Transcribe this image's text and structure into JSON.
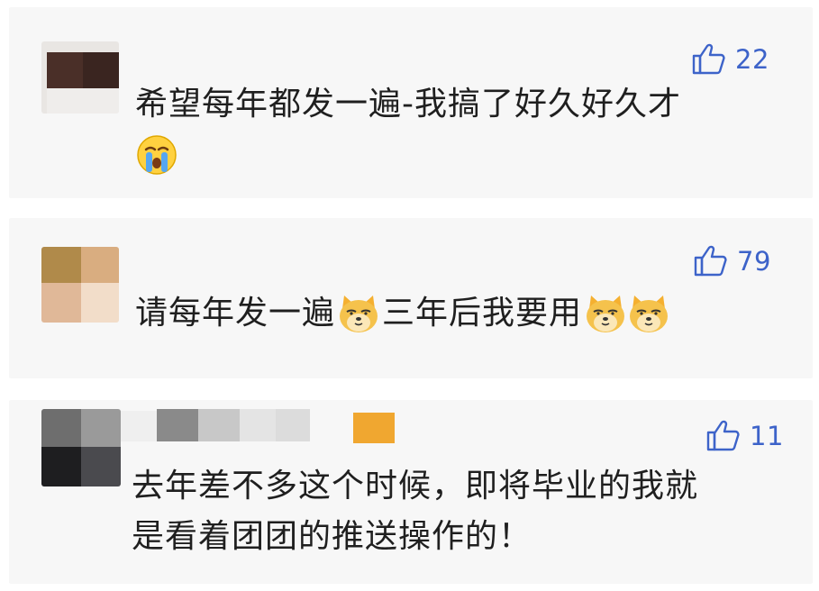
{
  "comments": [
    {
      "like_count": "22",
      "text_line1": "希望每年都发一遍-我搞了好久好久才",
      "emoji": "crying-face"
    },
    {
      "like_count": "79",
      "text_part1": "请每年发一遍",
      "text_part2": "三年后我要用",
      "emoji": "doge-face"
    },
    {
      "like_count": "11",
      "text_line1": "去年差不多这个时候，即将毕业的我就",
      "text_line2": "是看着团团的推送操作的！"
    }
  ],
  "colors": {
    "card_bg": "#f7f7f7",
    "like_blue": "#3d63c9",
    "text": "#1f1f1f"
  },
  "icons": {
    "like": "thumbs-up-icon",
    "emoji_1": "crying-face-emoji",
    "emoji_2": "doge-face-emoji"
  }
}
